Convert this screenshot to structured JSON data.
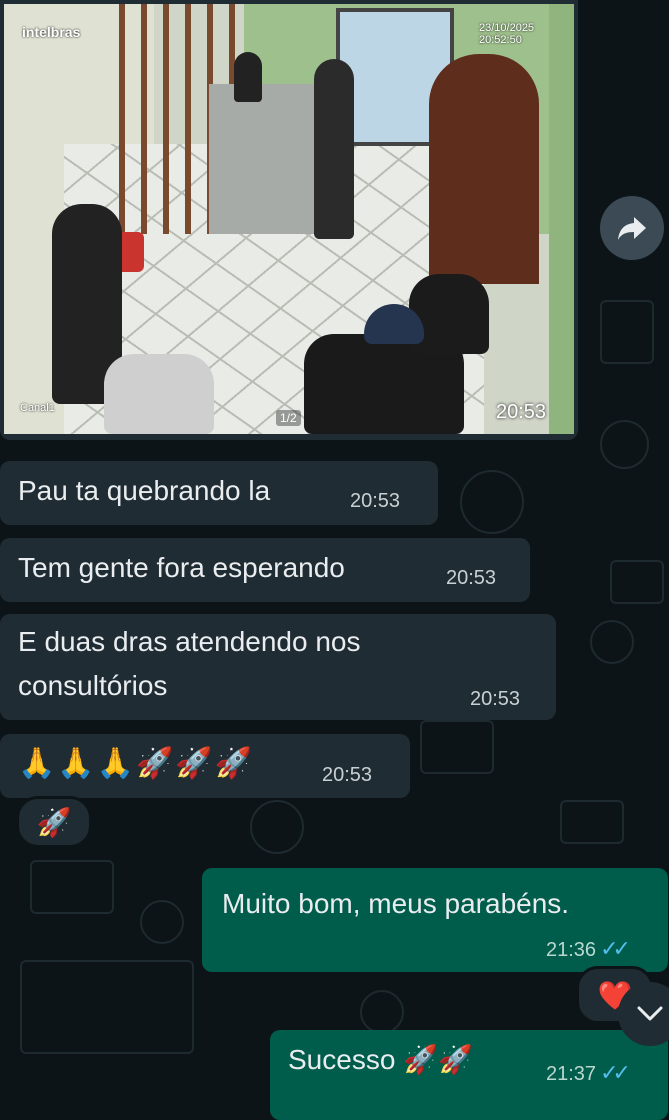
{
  "image_message": {
    "brand": "intelbras",
    "timestamp_overlay": "23/10/2025 20:52:50",
    "channel": "Canal1",
    "page_indicator": "1/2",
    "time": "20:53"
  },
  "incoming": [
    {
      "text": "Pau ta quebrando la",
      "time": "20:53"
    },
    {
      "text": "Tem gente fora esperando",
      "time": "20:53"
    },
    {
      "text_line1": "E duas dras atendendo nos",
      "text_line2": "consultórios",
      "time": "20:53"
    },
    {
      "text": "🙏🙏🙏🚀🚀🚀",
      "time": "20:53"
    }
  ],
  "incoming_reaction": "🚀",
  "outgoing": [
    {
      "text": "Muito bom, meus parabéns.",
      "time": "21:36",
      "status": "read"
    },
    {
      "text": "Sucesso 🚀🚀",
      "time": "21:37",
      "status": "read"
    }
  ],
  "outgoing_reaction": "❤️",
  "icons": {
    "forward": "forward-arrow-icon",
    "scroll": "chevron-down-icon",
    "read_receipt": "double-check-icon"
  },
  "colors": {
    "background": "#0d1418",
    "incoming_bubble": "#202c33",
    "outgoing_bubble": "#005c4b",
    "read_tick": "#53bdeb"
  }
}
